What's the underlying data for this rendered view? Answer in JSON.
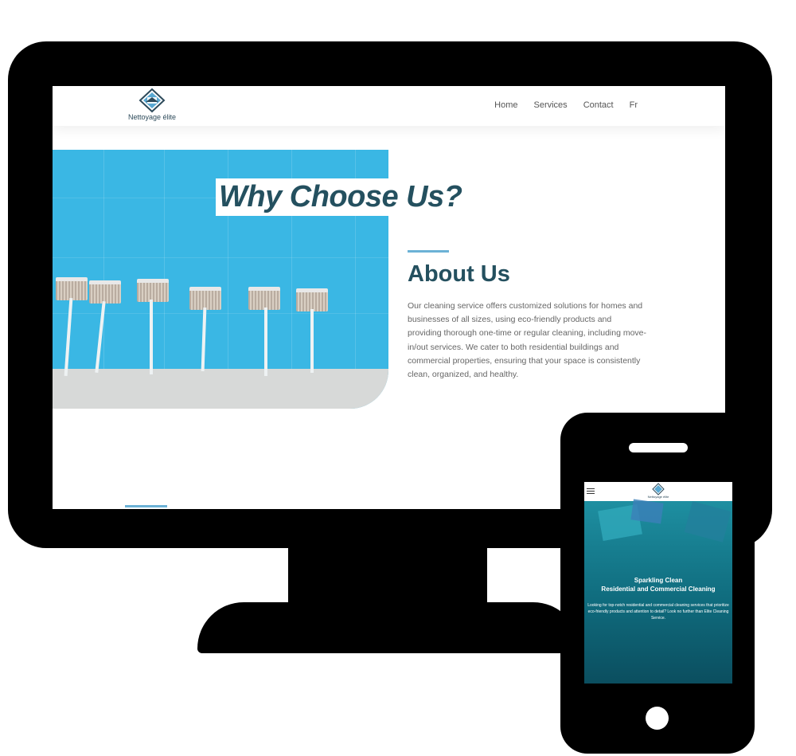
{
  "site": {
    "logo_text": "Nettoyage élite",
    "nav": [
      "Home",
      "Services",
      "Contact",
      "Fr"
    ]
  },
  "hero": {
    "overlay_title": "Why Choose Us?"
  },
  "about": {
    "title": "About Us",
    "body": "Our cleaning service offers customized solutions for homes and businesses of all sizes, using eco-friendly products and providing thorough one-time or regular cleaning, including move-in/out services. We cater to both residential buildings and commercial properties, ensuring that your space is consistently clean, organized, and healthy."
  },
  "mobile": {
    "logo_text": "Nettoyage élite",
    "hero_title_line1": "Sparkling Clean",
    "hero_title_line2": "Residential and Commercial Cleaning",
    "hero_body": "Looking for top-notch residential and commercial cleaning services that prioritize eco-friendly products and attention to detail? Look no further than Elite Cleaning Service."
  },
  "colors": {
    "brand_dark": "#24505f",
    "accent": "#6cb2d6",
    "hero_blue": "#3ab7e4",
    "mobile_teal": "#0f5a6a"
  },
  "icons": [
    "diamond-logo-icon",
    "hamburger-menu-icon"
  ]
}
